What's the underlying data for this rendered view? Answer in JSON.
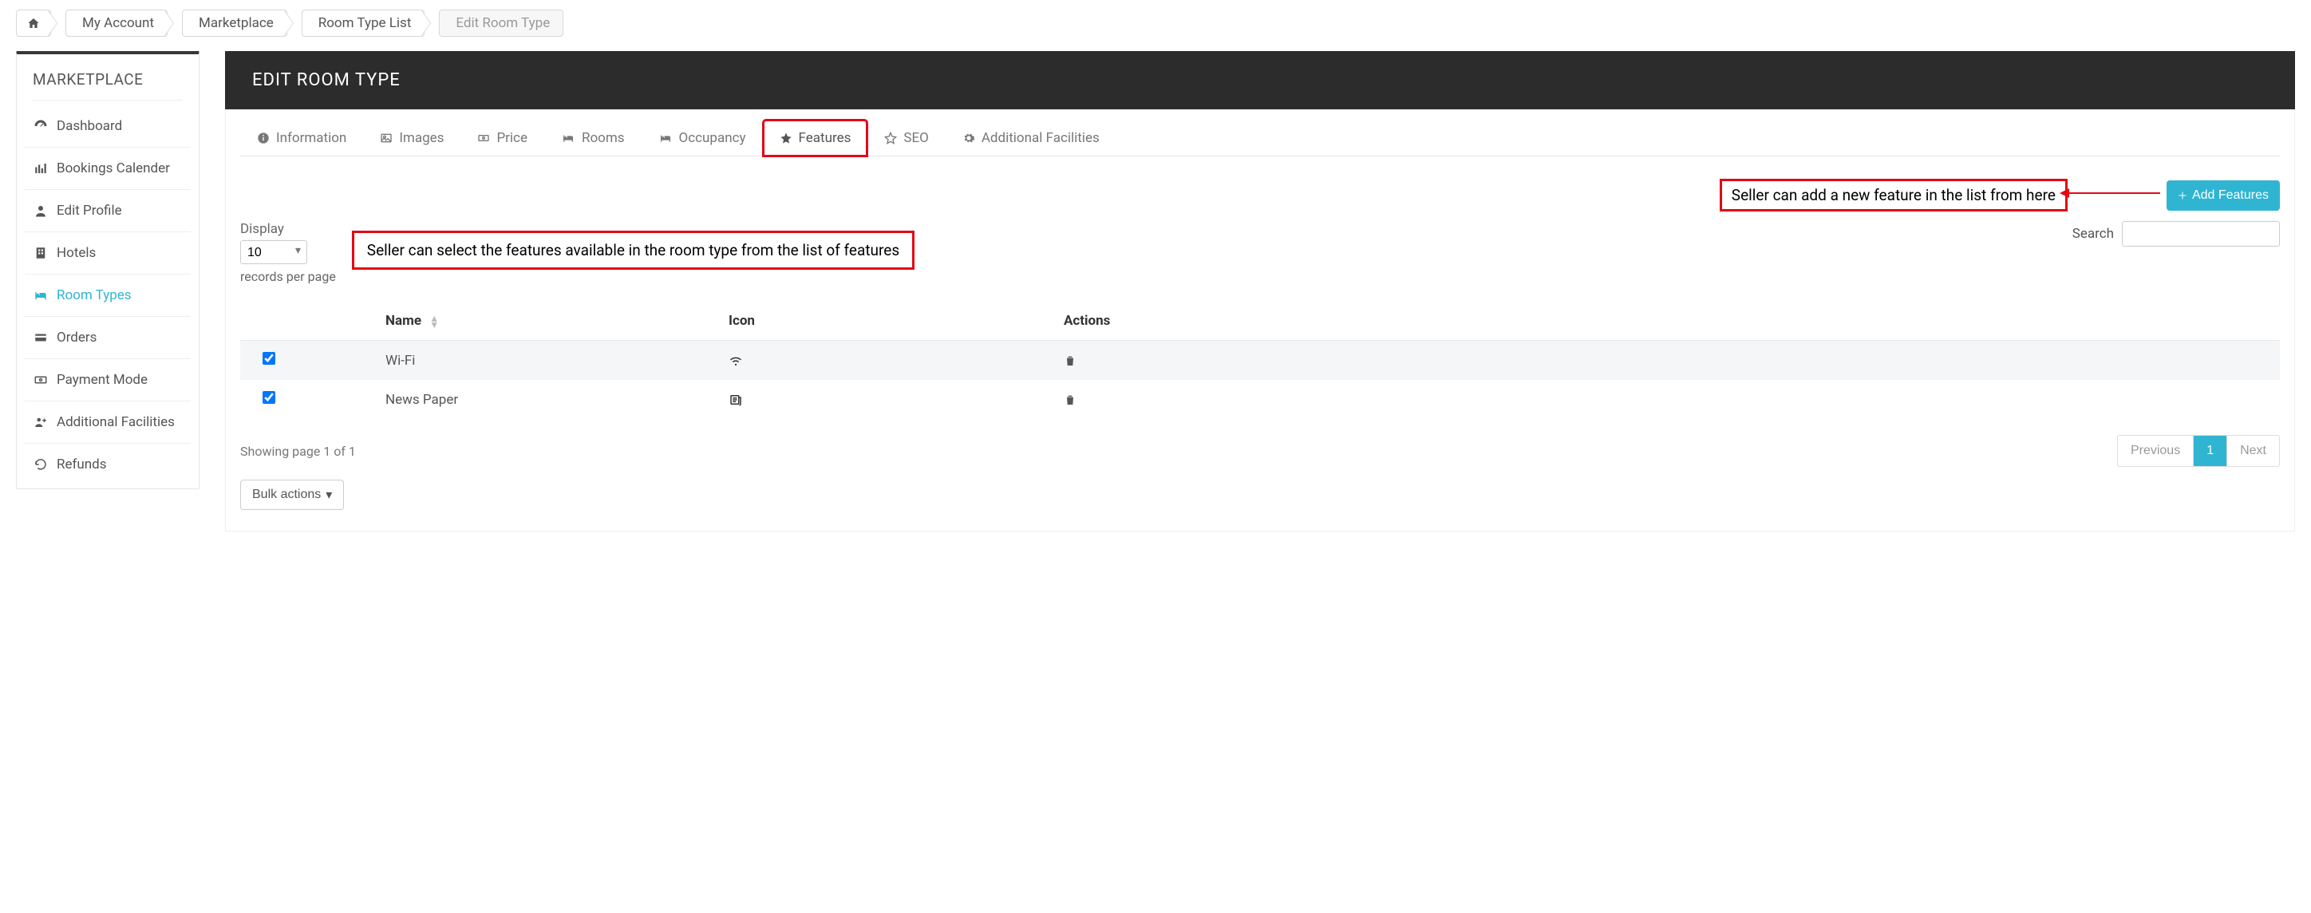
{
  "breadcrumb": {
    "home_icon": "home",
    "items": [
      "My Account",
      "Marketplace",
      "Room Type List"
    ],
    "current": "Edit Room Type"
  },
  "sidebar": {
    "title": "MARKETPLACE",
    "items": [
      {
        "label": "Dashboard",
        "icon": "dashboard"
      },
      {
        "label": "Bookings Calender",
        "icon": "bars"
      },
      {
        "label": "Edit Profile",
        "icon": "user"
      },
      {
        "label": "Hotels",
        "icon": "building"
      },
      {
        "label": "Room Types",
        "icon": "bed",
        "active": true
      },
      {
        "label": "Orders",
        "icon": "card"
      },
      {
        "label": "Payment Mode",
        "icon": "money"
      },
      {
        "label": "Additional Facilities",
        "icon": "users-plus"
      },
      {
        "label": "Refunds",
        "icon": "undo"
      }
    ]
  },
  "page": {
    "title": "EDIT ROOM TYPE"
  },
  "tabs": [
    {
      "label": "Information",
      "icon": "info"
    },
    {
      "label": "Images",
      "icon": "image"
    },
    {
      "label": "Price",
      "icon": "money"
    },
    {
      "label": "Rooms",
      "icon": "bed"
    },
    {
      "label": "Occupancy",
      "icon": "bed"
    },
    {
      "label": "Features",
      "icon": "star-solid",
      "active": true,
      "highlight": true
    },
    {
      "label": "SEO",
      "icon": "star-outline"
    },
    {
      "label": "Additional Facilities",
      "icon": "gear"
    }
  ],
  "annotations": {
    "add_feature_note": "Seller can add a new feature in the list from here",
    "select_feature_note": "Seller can select the features available in the room type from the list of features"
  },
  "buttons": {
    "add_features": "Add Features"
  },
  "table": {
    "display_label": "Display",
    "display_value": "10",
    "records_per_page": "records per page",
    "search_label": "Search",
    "search_value": "",
    "columns": {
      "name": "Name",
      "icon": "Icon",
      "actions": "Actions"
    },
    "rows": [
      {
        "checked": true,
        "name": "Wi-Fi",
        "icon": "wifi"
      },
      {
        "checked": true,
        "name": "News Paper",
        "icon": "newspaper"
      }
    ],
    "footer_info": "Showing page 1 of 1",
    "pager": {
      "prev": "Previous",
      "page": "1",
      "next": "Next"
    },
    "bulk_label": "Bulk actions"
  }
}
